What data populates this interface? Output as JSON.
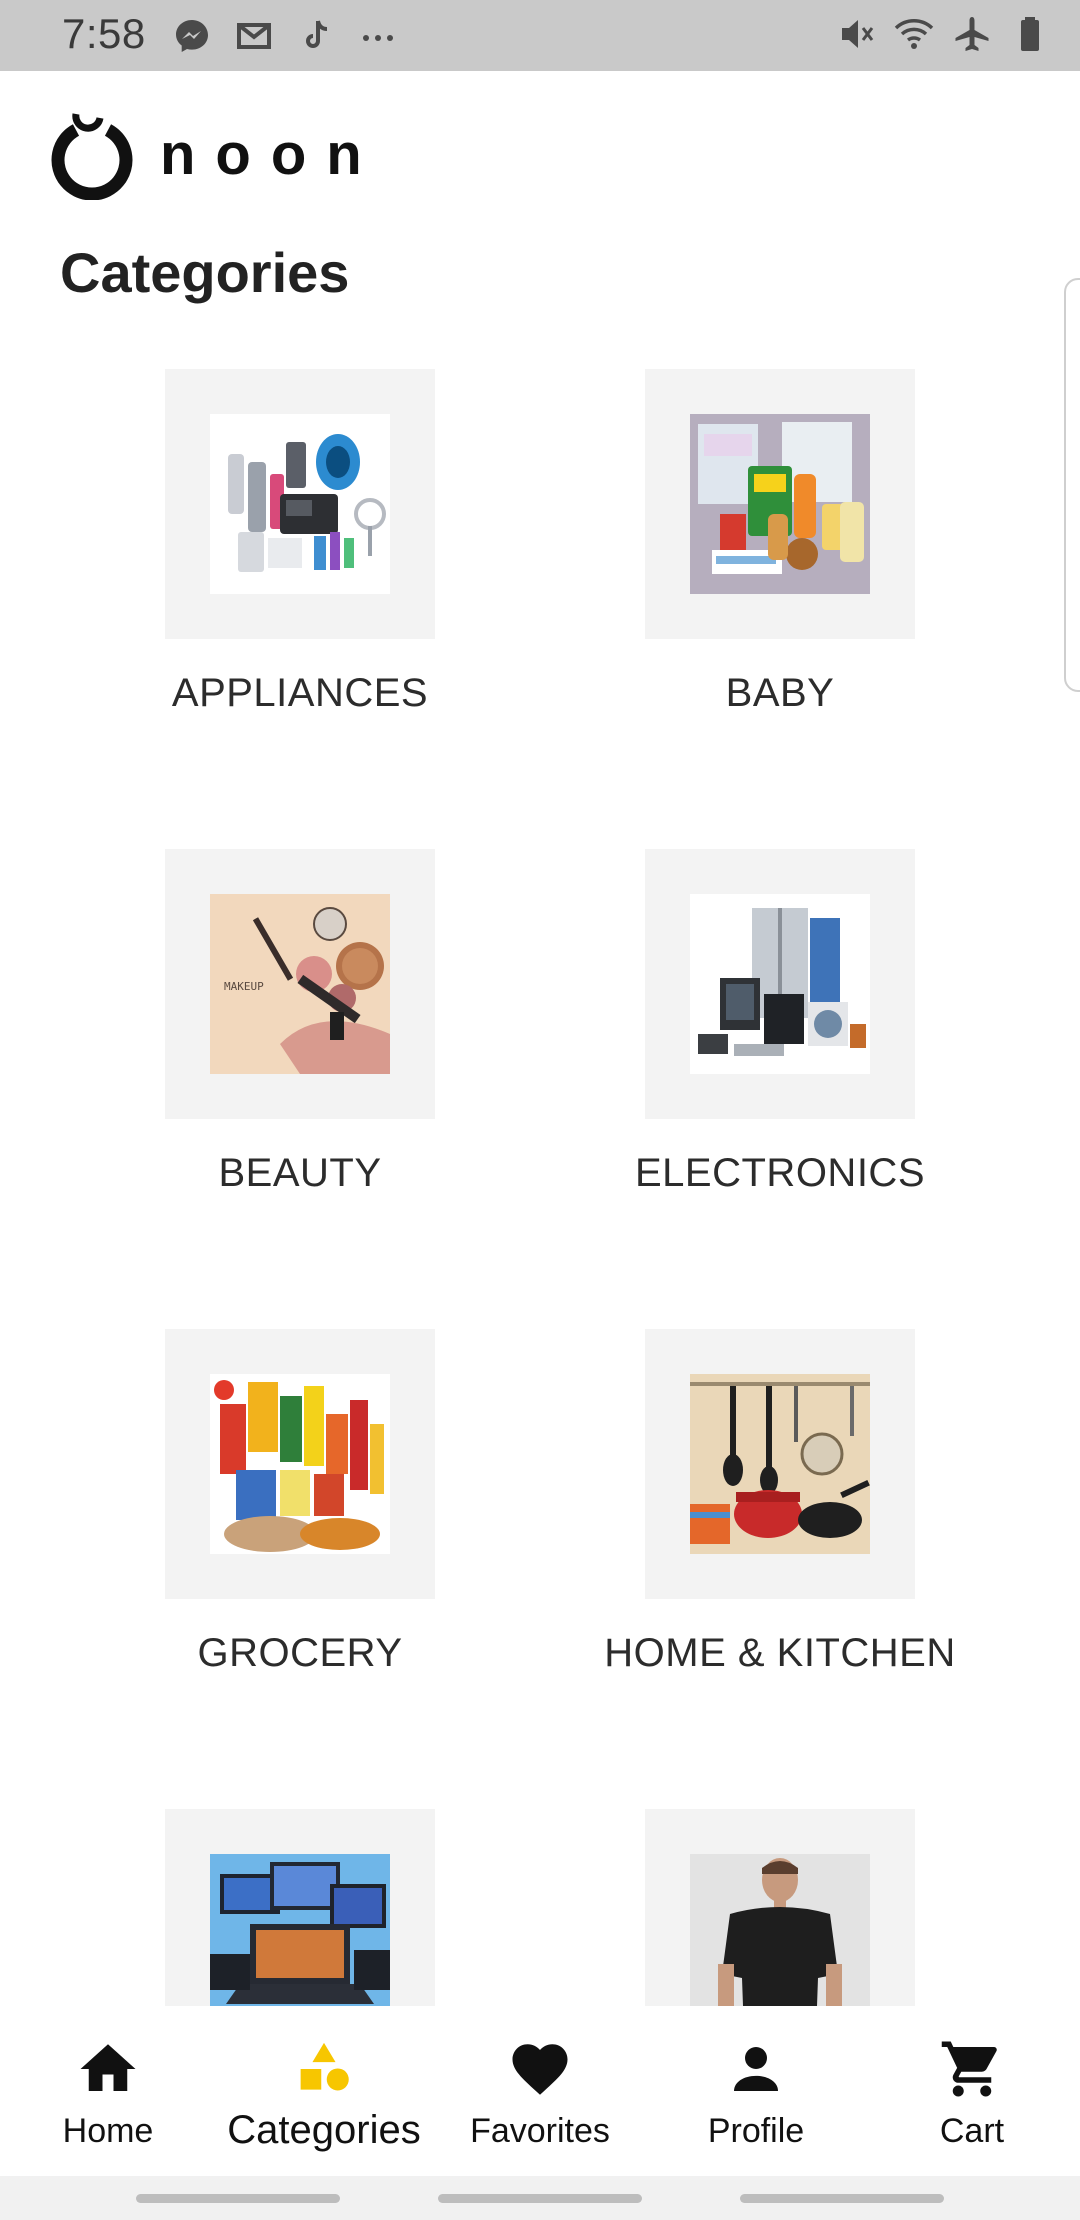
{
  "status_bar": {
    "time": "7:58",
    "left_icons": [
      "messenger-icon",
      "gmail-icon",
      "tiktok-icon",
      "more-icon"
    ],
    "right_icons": [
      "mute-icon",
      "wifi-icon",
      "airplane-icon",
      "battery-icon"
    ]
  },
  "header": {
    "logo_text": "noon"
  },
  "page": {
    "title": "Categories"
  },
  "categories": [
    {
      "label": "APPLIANCES"
    },
    {
      "label": "BABY"
    },
    {
      "label": "BEAUTY"
    },
    {
      "label": "ELECTRONICS"
    },
    {
      "label": "GROCERY"
    },
    {
      "label": "HOME & KITCHEN"
    },
    {
      "label": ""
    },
    {
      "label": ""
    }
  ],
  "bottom_nav": {
    "items": [
      {
        "label": "Home",
        "icon": "home-icon"
      },
      {
        "label": "Categories",
        "icon": "categories-icon",
        "active": true
      },
      {
        "label": "Favorites",
        "icon": "heart-icon"
      },
      {
        "label": "Profile",
        "icon": "person-icon"
      },
      {
        "label": "Cart",
        "icon": "cart-icon"
      }
    ]
  },
  "colors": {
    "status_bar_bg": "#c9c9c9",
    "tile_bg": "#f3f3f3",
    "active_icon": "#f7c600",
    "text": "#222222"
  }
}
